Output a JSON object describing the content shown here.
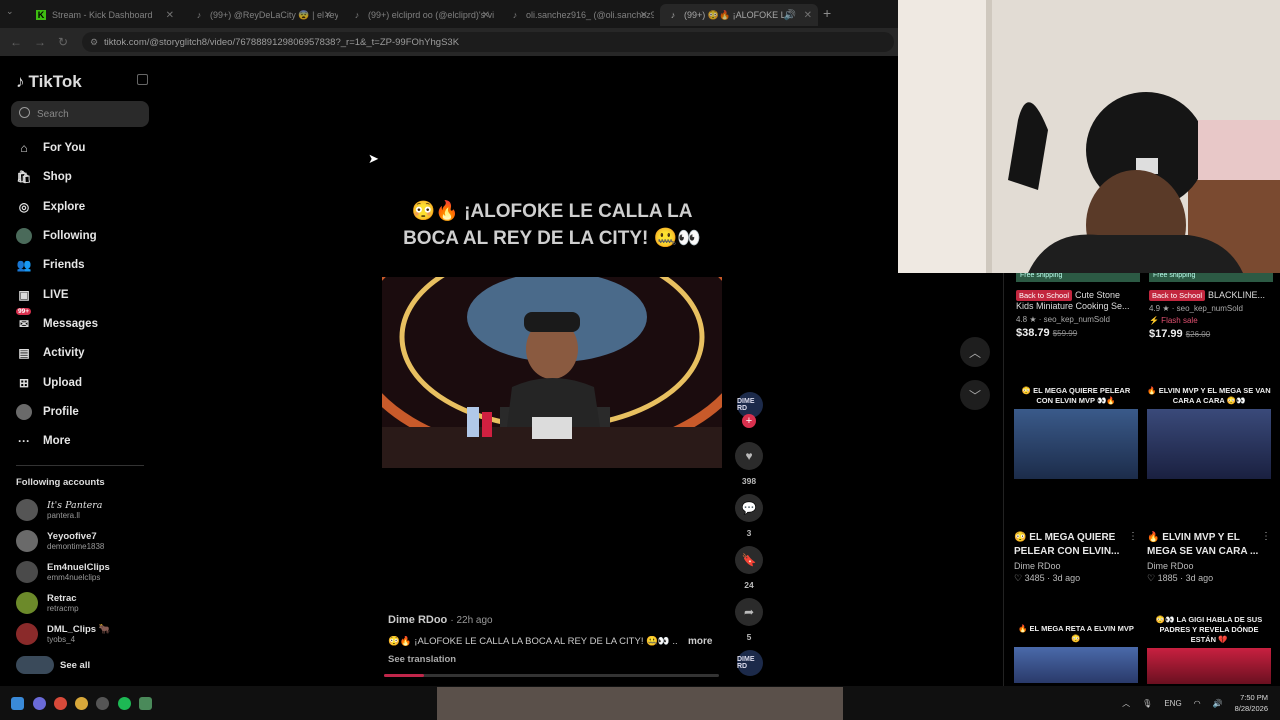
{
  "browser": {
    "tabs": [
      {
        "title": "Stream - Kick Dashboard",
        "icon": "K"
      },
      {
        "title": "(99+) @ReyDeLaCity 😨 | el rey",
        "icon": "♪"
      },
      {
        "title": "(99+) elclipr‌d oo (@elcliprd)'s vi",
        "icon": "♪"
      },
      {
        "title": "oli.sanchez916_ (@oli.sanchez9",
        "icon": "♪"
      },
      {
        "title": "(99+) 😳🔥 ¡ALOFOKE LE C",
        "icon": "♪"
      }
    ],
    "new_tab": "+",
    "url": "tiktok.com/@storyglitch8/video/7678889129806957838?_r=1&_t=ZP-99FOhYhgS3K"
  },
  "sidebar": {
    "logo": "TikTok",
    "search_placeholder": "Search",
    "nav": [
      {
        "label": "For You",
        "icon": "⌂"
      },
      {
        "label": "Shop",
        "icon": "🛍"
      },
      {
        "label": "Explore",
        "icon": "◎"
      },
      {
        "label": "Following",
        "icon": "●"
      },
      {
        "label": "Friends",
        "icon": "👥"
      },
      {
        "label": "LIVE",
        "icon": "▣"
      },
      {
        "label": "Messages",
        "icon": "✉"
      },
      {
        "label": "Activity",
        "icon": "▤"
      },
      {
        "label": "Upload",
        "icon": "⊞"
      },
      {
        "label": "Profile",
        "icon": "●"
      },
      {
        "label": "More",
        "icon": "···"
      }
    ],
    "messages_badge": "99+",
    "following_title": "Following accounts",
    "accounts": [
      {
        "name": "It's Pantera",
        "handle": "pantera.ll",
        "color": "#555"
      },
      {
        "name": "Yeyoofive7",
        "handle": "demontime1838",
        "color": "#6a6a6a"
      },
      {
        "name": "Em4nuelClips",
        "handle": "emm4nuelclips",
        "color": "#4a4a4a"
      },
      {
        "name": "Retrac",
        "handle": "retracmp",
        "color": "#6c8a2a"
      },
      {
        "name": "DML_Clips 🐂",
        "handle": "tyobs_4",
        "color": "#8a2a2a"
      }
    ],
    "see_all": "See all"
  },
  "video": {
    "title": "😳🔥 ¡ALOFOKE LE CALLA LA BOCA AL REY DE LA CITY! 🤐👀",
    "author": "Dime RDoo",
    "time": "22h ago",
    "caption": "😳🔥 ¡ALOFOKE LE CALLA LA BOCA AL REY DE LA CITY! 🤐👀 ...",
    "more": "more",
    "see_translation": "See translation",
    "progress": 0.12,
    "creator_avatar": "DIME RD",
    "likes": "398",
    "comments": "3",
    "saves": "24",
    "shares": "5"
  },
  "right_panel": {
    "products": [
      {
        "ship": "Free shipping",
        "badge": "Back to School",
        "title": "Cute Stone Kids Miniature Cooking Se...",
        "rating": "4.8 ★ · seo_kep_numSold",
        "flash": "",
        "price": "$38.79",
        "old": "$59.99"
      },
      {
        "ship": "Free shipping",
        "badge": "Back to School",
        "title": "BLACKLINE...",
        "rating": "4.9 ★ · seo_kep_numSold",
        "flash": "⚡ Flash sale",
        "price": "$17.99",
        "old": "$26.00"
      }
    ],
    "videos": [
      {
        "cap": "😳 EL MEGA QUIERE PELEAR CON ELVIN MVP 👀🔥",
        "title": "😳 EL MEGA QUIERE PELEAR CON ELVIN...",
        "author": "Dime RDoo",
        "stats": "♡ 3485 · 3d ago"
      },
      {
        "cap": "🔥 ELVIN MVP Y EL MEGA SE VAN CARA A CARA 😳👀",
        "title": "🔥 ELVIN MVP Y EL MEGA SE VAN CARA ...",
        "author": "Dime RDoo",
        "stats": "♡ 1885 · 3d ago"
      },
      {
        "cap": "🔥 EL MEGA RETA A ELVIN MVP 😳",
        "title": "",
        "author": "",
        "stats": ""
      },
      {
        "cap": "😳👀 LA GIGI HABLA DE SUS PADRES Y REVELA DÓNDE ESTÁN 💔",
        "title": "",
        "author": "",
        "stats": ""
      }
    ]
  },
  "taskbar": {
    "lang": "ENG",
    "time": "7:50 PM",
    "date": "8/28/2026"
  }
}
